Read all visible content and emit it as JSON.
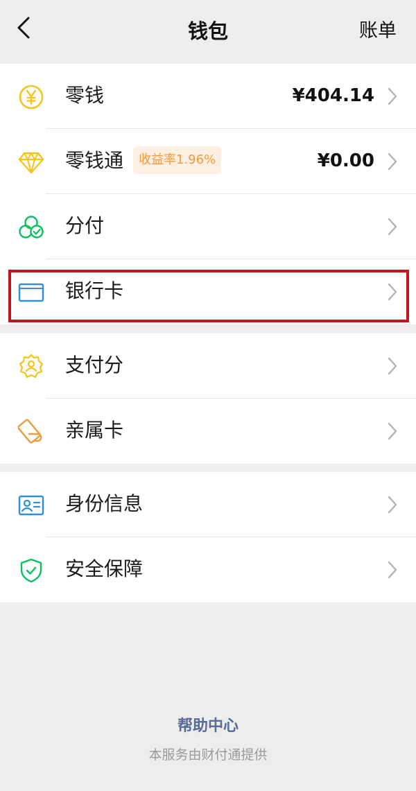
{
  "header": {
    "title": "钱包",
    "right_label": "账单"
  },
  "colors": {
    "background": "#ededed",
    "card": "#ffffff",
    "coin": "#f5c31b",
    "diamond": "#f5c31b",
    "fenfu": "#07c160",
    "bank": "#2f8fde",
    "score": "#f5c31b",
    "family": "#f09a3b",
    "identity": "#2f8fde",
    "security": "#07c160",
    "badge_bg": "#fdefe1",
    "badge_text": "#f09a3b",
    "link": "#576b95",
    "highlight": "#c1161c"
  },
  "group1": {
    "items": [
      {
        "icon": "yuan-coin-icon",
        "label": "零钱",
        "value": "¥404.14"
      },
      {
        "icon": "diamond-icon",
        "label": "零钱通",
        "badge": "收益率1.96%",
        "value": "¥0.00"
      },
      {
        "icon": "fenfu-icon",
        "label": "分付"
      },
      {
        "icon": "bank-card-icon",
        "label": "银行卡"
      }
    ]
  },
  "group2": {
    "items": [
      {
        "icon": "payment-score-icon",
        "label": "支付分"
      },
      {
        "icon": "family-card-icon",
        "label": "亲属卡"
      }
    ]
  },
  "group3": {
    "items": [
      {
        "icon": "id-card-icon",
        "label": "身份信息"
      },
      {
        "icon": "shield-check-icon",
        "label": "安全保障"
      }
    ]
  },
  "footer": {
    "help_label": "帮助中心",
    "note": "本服务由财付通提供"
  }
}
